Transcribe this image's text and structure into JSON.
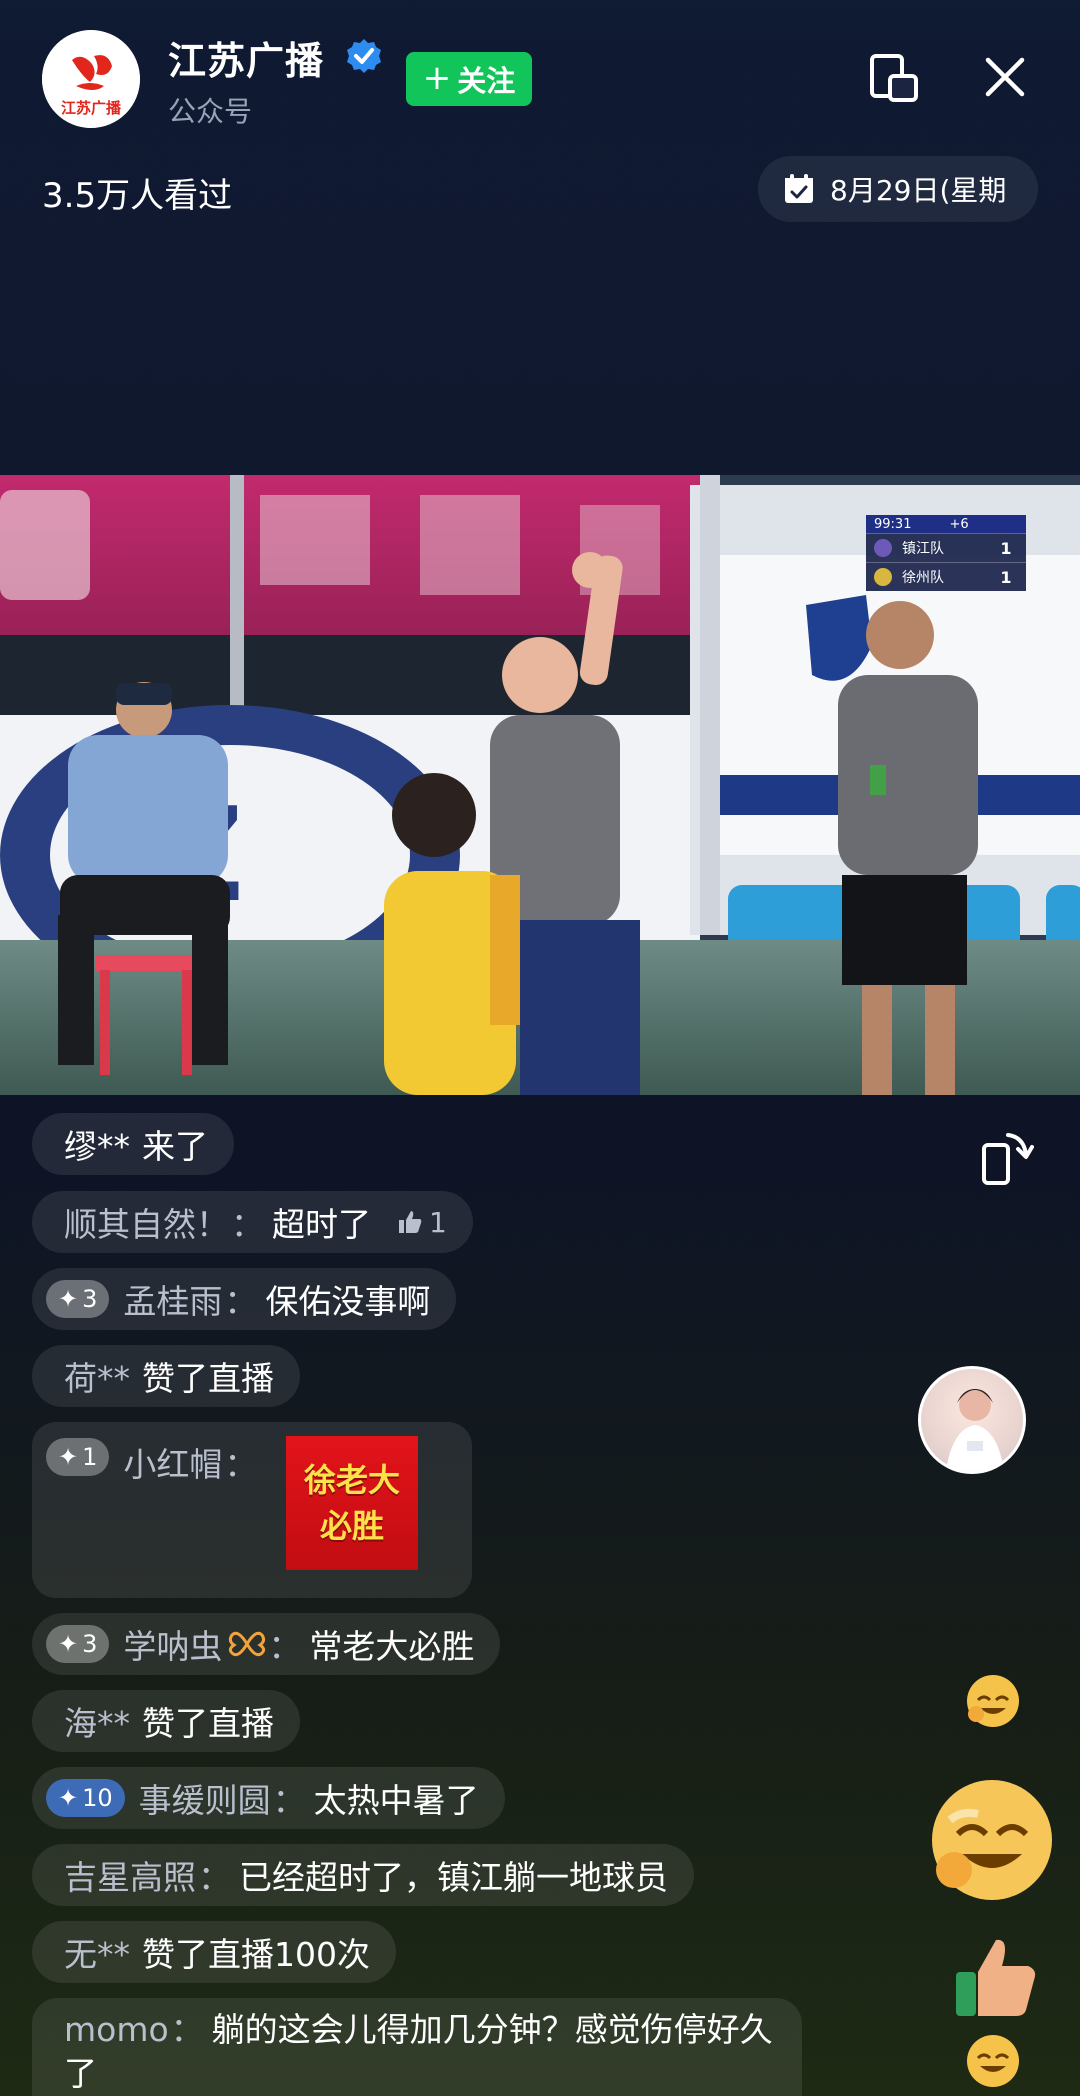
{
  "header": {
    "channel_name": "江苏广播",
    "channel_type": "公众号",
    "logo_text": "江苏广播",
    "follow_label": "关注",
    "view_count": "3.5万人看过",
    "date_text": "8月29日(星期"
  },
  "scoreboard": {
    "clock": "99:31",
    "added": "+6",
    "home_team": "镇江队",
    "home_score": "1",
    "away_team": "徐州队",
    "away_score": "1"
  },
  "comments": [
    {
      "user": "缪**",
      "message": "来了",
      "type": "join"
    },
    {
      "user": "顺其自然！",
      "message": "超时了",
      "likes": "1"
    },
    {
      "badge": "3",
      "user": "孟桂雨",
      "message": "保佑没事啊"
    },
    {
      "user": "荷**",
      "message": "赞了直播",
      "type": "like"
    },
    {
      "badge": "1",
      "user": "小红帽",
      "sticker_line1": "徐老大",
      "sticker_line2": "必胜"
    },
    {
      "badge": "3",
      "user": "学呐虫",
      "message": "常老大必胜"
    },
    {
      "user": "海**",
      "message": "赞了直播",
      "type": "like"
    },
    {
      "badge": "10",
      "user": "事缓则圆",
      "message": "太热中暑了"
    },
    {
      "user": "吉星高照",
      "message": "已经超时了，镇江躺一地球员"
    },
    {
      "user": "无**",
      "message": "赞了直播100次",
      "type": "like"
    },
    {
      "user": "momo",
      "message": "躺的这会儿得加几分钟？感觉伤停好久了"
    }
  ],
  "colors": {
    "follow_green": "#12c55a",
    "verified_blue": "#2d8cf0",
    "badge_blue": "#3e6bb6",
    "sticker_red": "#e2141a"
  }
}
